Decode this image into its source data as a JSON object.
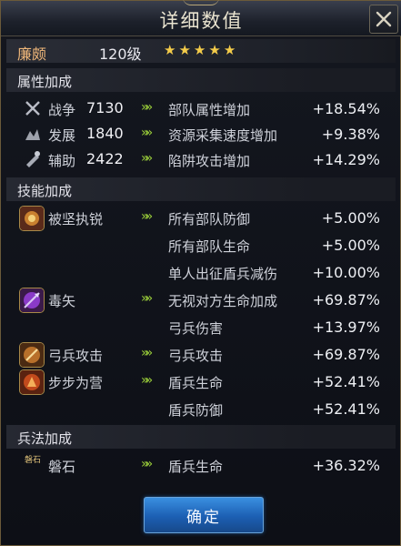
{
  "window": {
    "title": "详细数值",
    "close_label": "✕"
  },
  "hero": {
    "name": "廉颇",
    "level": "120级",
    "stars": 5
  },
  "sections": {
    "attr": "属性加成",
    "skill": "技能加成",
    "tactic": "兵法加成"
  },
  "attr_rows": [
    {
      "label": "战争",
      "value": "7130",
      "effect": "部队属性增加",
      "pct": "+18.54%",
      "icon": "war-icon"
    },
    {
      "label": "发展",
      "value": "1840",
      "effect": "资源采集速度增加",
      "pct": "+9.38%",
      "icon": "develop-icon"
    },
    {
      "label": "辅助",
      "value": "2422",
      "effect": "陷阱攻击增加",
      "pct": "+14.29%",
      "icon": "assist-icon"
    }
  ],
  "skill_rows": [
    {
      "label": "被坚执锐",
      "effect": "所有部队防御",
      "pct": "+5.00%",
      "icon": "shield-skill-icon"
    },
    {
      "label": "",
      "effect": "所有部队生命",
      "pct": "+5.00%"
    },
    {
      "label": "",
      "effect": "单人出征盾兵减伤",
      "pct": "+10.00%"
    },
    {
      "label": "毒矢",
      "effect": "无视对方生命加成",
      "pct": "+69.87%",
      "icon": "poison-arrow-icon"
    },
    {
      "label": "",
      "effect": "弓兵伤害",
      "pct": "+13.97%"
    },
    {
      "label": "弓兵攻击",
      "effect": "弓兵攻击",
      "pct": "+69.87%",
      "icon": "archer-attack-icon"
    },
    {
      "label": "步步为营",
      "effect": "盾兵生命",
      "pct": "+52.41%",
      "icon": "step-by-step-icon"
    },
    {
      "label": "",
      "effect": "盾兵防御",
      "pct": "+52.41%"
    }
  ],
  "tactic_rows": [
    {
      "label": "磐石",
      "effect": "盾兵生命",
      "pct": "+36.32%",
      "icon": "rock-icon",
      "icon_text": "磐石"
    }
  ],
  "confirm_label": "确定",
  "colors": {
    "accent_green": "#9bcf3a",
    "hero_name": "#f1b87a",
    "button_blue": "#2a77cc"
  }
}
